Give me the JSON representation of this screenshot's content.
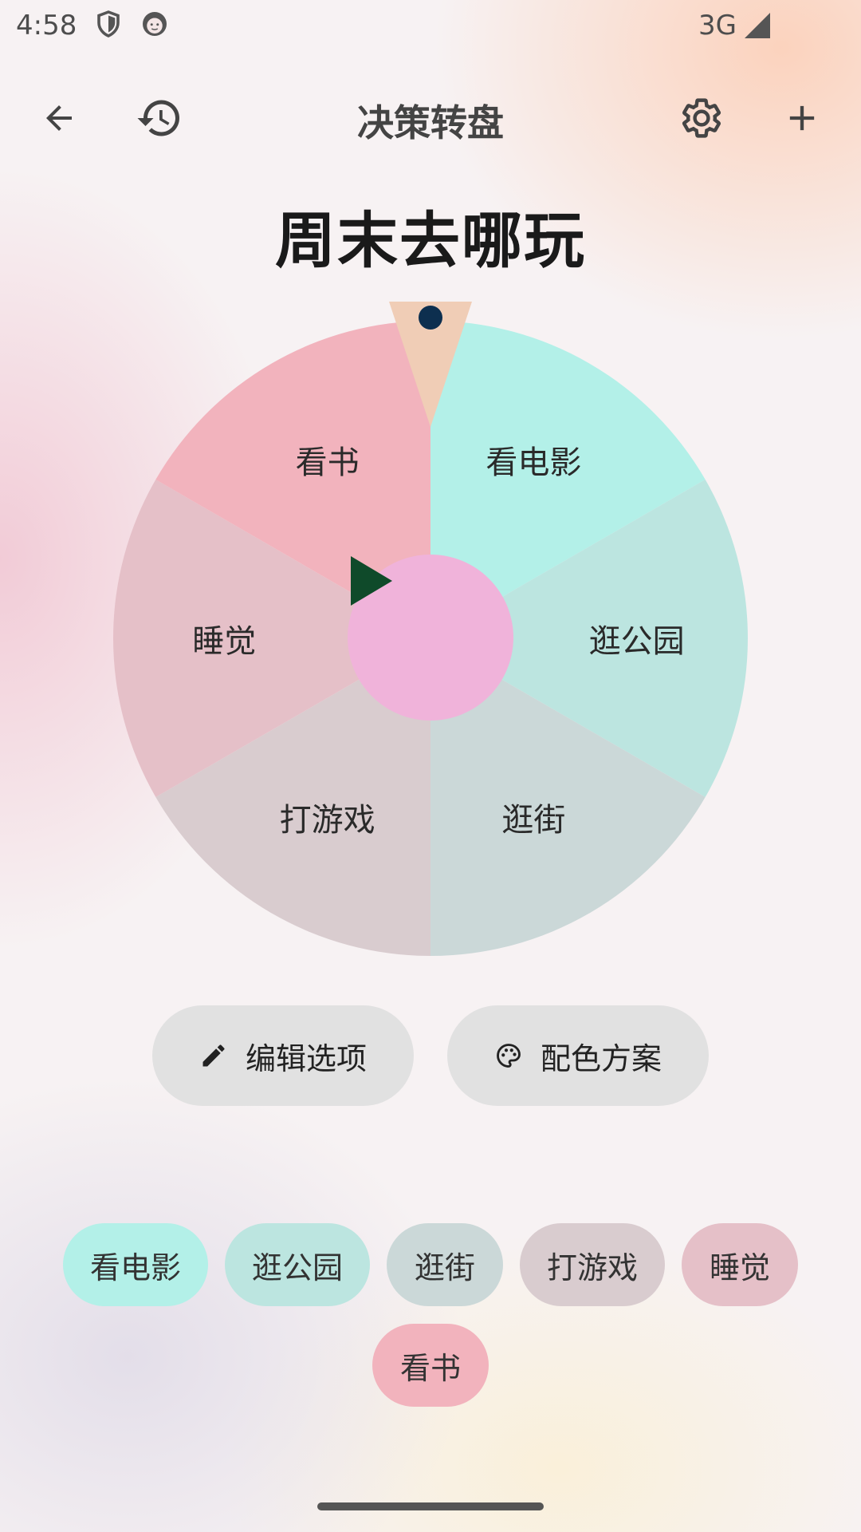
{
  "status_bar": {
    "time": "4:58",
    "network": "3G",
    "icons": [
      "shield-icon",
      "face-icon",
      "signal-icon"
    ]
  },
  "app_bar": {
    "title": "决策转盘",
    "icons": [
      "back-arrow-icon",
      "history-icon",
      "settings-gear-icon",
      "add-plus-icon"
    ]
  },
  "wheel": {
    "title": "周末去哪玩",
    "segments": [
      {
        "label": "看电影",
        "color": "#b3f0e8"
      },
      {
        "label": "逛公园",
        "color": "#bce5e0"
      },
      {
        "label": "逛街",
        "color": "#cbd8d8"
      },
      {
        "label": "打游戏",
        "color": "#d9cccf"
      },
      {
        "label": "睡觉",
        "color": "#e5c0c8"
      },
      {
        "label": "看书",
        "color": "#f2b3bd"
      }
    ],
    "pointer_color": "#f0cdb6",
    "pointer_dot_color": "#0d2f4f",
    "center_button_color": "#f0b3da",
    "play_icon_color": "#0f4a2a"
  },
  "actions": {
    "edit_label": "编辑选项",
    "theme_label": "配色方案"
  },
  "chips": [
    "看电影",
    "逛公园",
    "逛街",
    "打游戏",
    "睡觉",
    "看书"
  ]
}
